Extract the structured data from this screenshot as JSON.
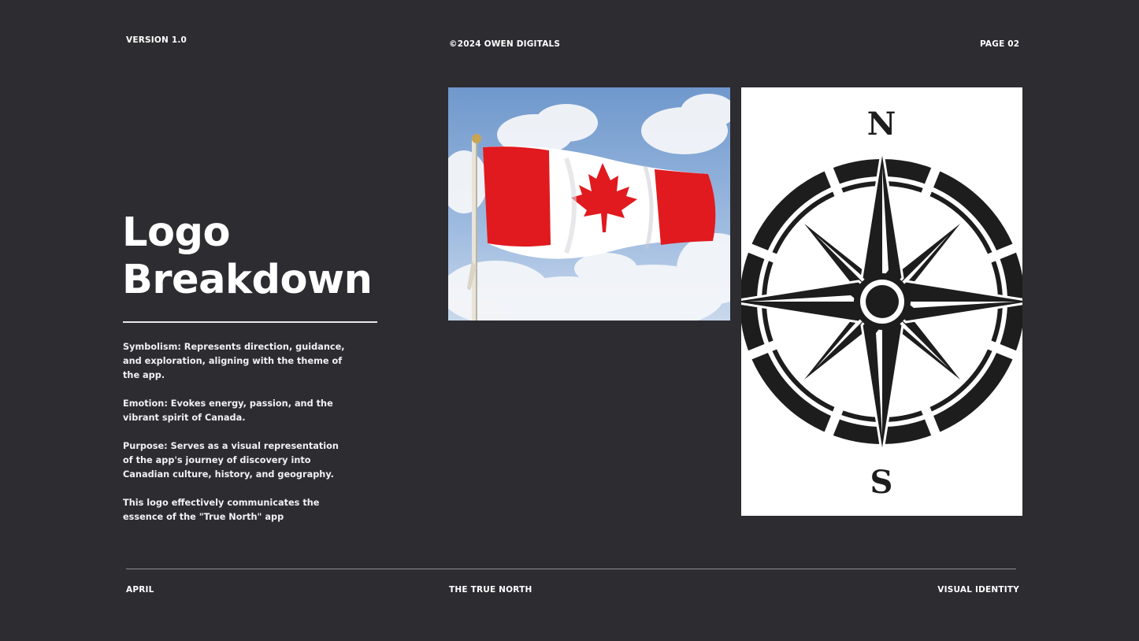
{
  "header": {
    "version": "VERSION 1.0",
    "copyright": "©2024 OWEN DIGITALS",
    "page": "PAGE 02"
  },
  "main": {
    "title_line1": "Logo",
    "title_line2": "Breakdown",
    "paragraphs": [
      "Symbolism: Represents direction, guidance, and exploration, aligning with the theme of the app.",
      "Emotion: Evokes energy, passion, and the vibrant spirit of Canada.",
      "Purpose: Serves as a visual representation of the app's journey of discovery into Canadian culture, history, and geography.",
      "This logo effectively communicates the essence of the \"True North\" app"
    ]
  },
  "images": {
    "flag": {
      "icon": "canadian-flag-photo"
    },
    "compass": {
      "icon": "compass-rose-icon",
      "north_label": "N",
      "south_label": "S"
    }
  },
  "footer": {
    "left": "APRIL",
    "center": "THE TRUE NORTH",
    "right": "VISUAL IDENTITY"
  },
  "colors": {
    "background": "#2d2c31",
    "text": "#ffffff",
    "flag_red": "#e01a1f",
    "sky_blue": "#7fa6d4"
  }
}
